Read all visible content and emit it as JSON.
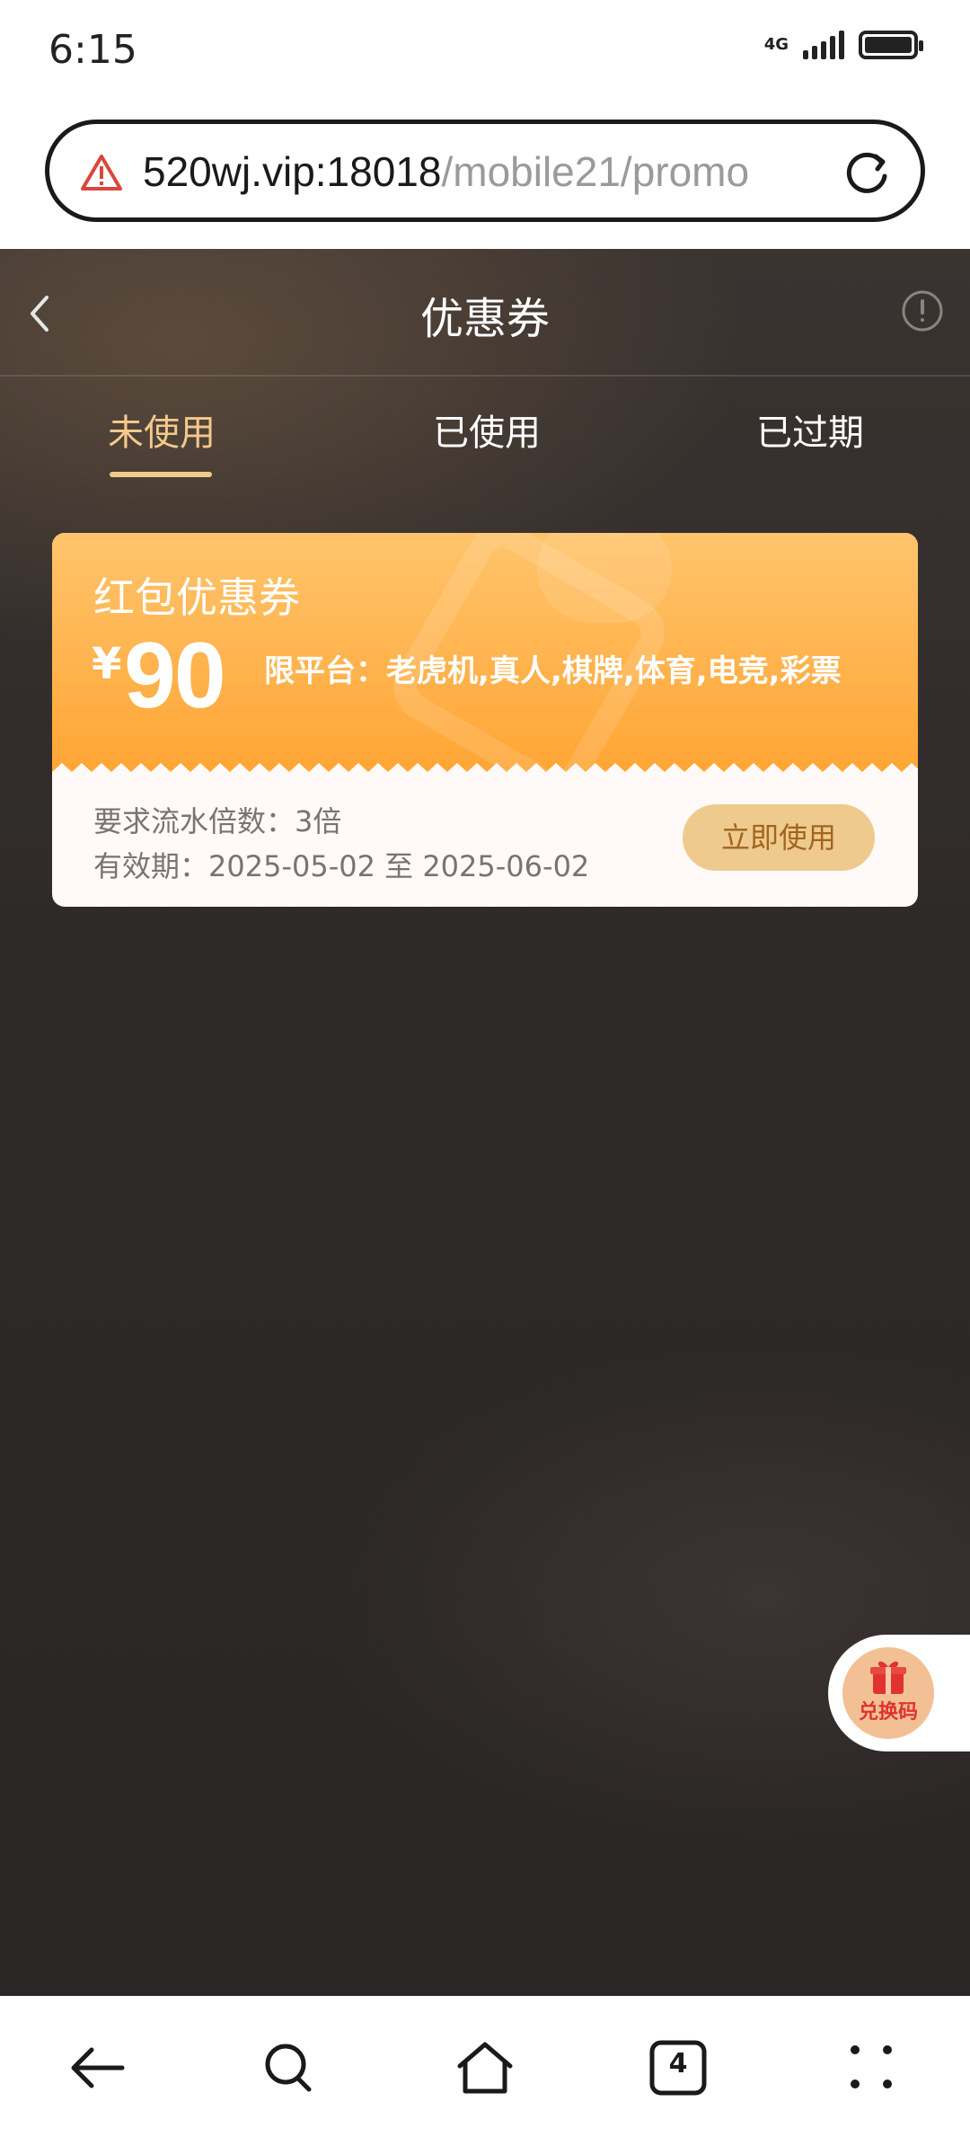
{
  "status_bar": {
    "time": "6:15",
    "network": "4G"
  },
  "browser": {
    "url_host": "520wj.vip:18018",
    "url_path": "/mobile21/promo"
  },
  "header": {
    "title": "优惠券"
  },
  "tabs": [
    {
      "label": "未使用",
      "active": true
    },
    {
      "label": "已使用",
      "active": false
    },
    {
      "label": "已过期",
      "active": false
    }
  ],
  "coupon": {
    "title": "红包优惠券",
    "currency": "¥",
    "amount": "90",
    "platforms": "限平台：老虎机,真人,棋牌,体育,电竞,彩票",
    "requirement": "要求流水倍数：3倍",
    "validity": "有效期：2025-05-02 至 2025-06-02",
    "button_label": "立即使用"
  },
  "redeem": {
    "label": "兑换码"
  },
  "bottom_nav": {
    "tab_count": "4"
  },
  "colors": {
    "accent": "#f3c98c",
    "coupon_orange": "#ffa534",
    "button_bg": "#eeca8f",
    "button_text": "#a2651d"
  }
}
